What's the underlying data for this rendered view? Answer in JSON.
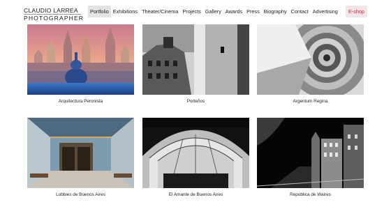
{
  "brand": {
    "name": "CLAUDIO LARREA",
    "subtitle": "PHOTOGRAPHER"
  },
  "nav": {
    "items": [
      {
        "label": "Portfolio",
        "active": true
      },
      {
        "label": "Exhibitions"
      },
      {
        "label": "Theater/Cinema"
      },
      {
        "label": "Projects"
      },
      {
        "label": "Gallery"
      },
      {
        "label": "Awards"
      },
      {
        "label": "Press"
      },
      {
        "label": "Biography"
      },
      {
        "label": "Contact"
      },
      {
        "label": "Advertising"
      }
    ],
    "eshop": "E-shop"
  },
  "gallery": {
    "items": [
      {
        "caption": "Arquitectura Peronista"
      },
      {
        "caption": "Porteños"
      },
      {
        "caption": "Argentum Regina"
      },
      {
        "caption": "Lobbies de Buenos Aires"
      },
      {
        "caption": "El Amante de Buenos Aires"
      },
      {
        "caption": "República de Waires"
      }
    ]
  },
  "colors": {
    "accent": "#d0243a",
    "active_nav_bg": "#e3e3e3"
  }
}
